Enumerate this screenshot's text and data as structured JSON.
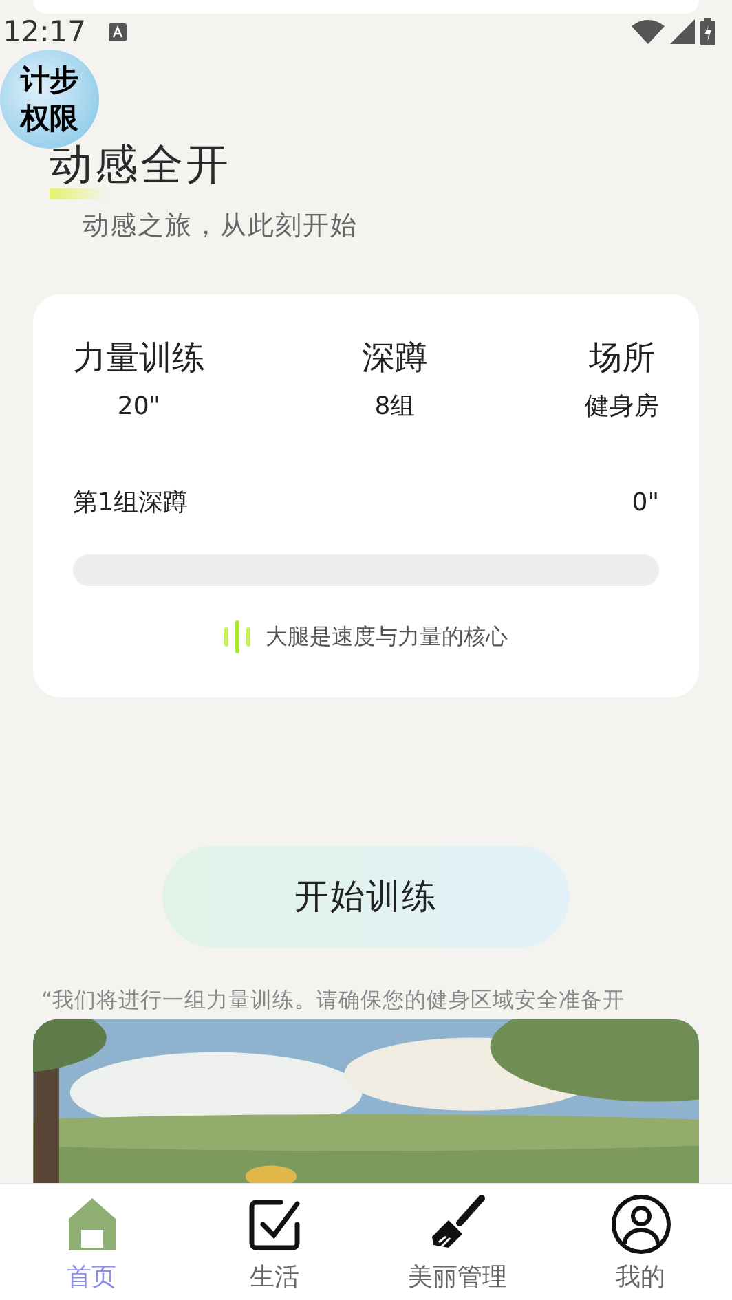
{
  "status_bar": {
    "time": "12:17"
  },
  "overlay_badge": {
    "lines": [
      "计步",
      "权限"
    ]
  },
  "header": {
    "title": "动感全开",
    "subtitle": "动感之旅，从此刻开始"
  },
  "workout_card": {
    "stats": [
      {
        "label": "力量训练",
        "value": "20\""
      },
      {
        "label": "深蹲",
        "value": "8组"
      },
      {
        "label": "场所",
        "value": "健身房"
      }
    ],
    "set_label": "第1组深蹲",
    "set_time": "0\"",
    "level": 0,
    "tip": "大腿是速度与力量的核心"
  },
  "start_button": "开始训练",
  "quote": "“我们将进行一组力量训练。请确保您的健身区域安全准备开",
  "tab_bar": [
    {
      "label": "首页",
      "kind": "home",
      "selected": true
    },
    {
      "label": "生活",
      "kind": "check",
      "selected": false
    },
    {
      "label": "美丽管理",
      "kind": "brush",
      "selected": false
    },
    {
      "label": "我的",
      "kind": "user",
      "selected": false
    }
  ]
}
